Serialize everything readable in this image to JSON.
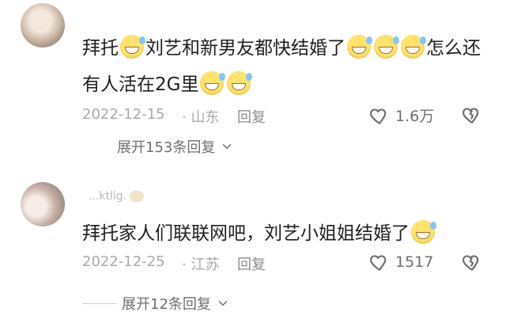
{
  "comments": [
    {
      "username": "",
      "text_parts": [
        {
          "t": "text",
          "v": "拜托"
        },
        {
          "t": "emoji",
          "name": "laugh-sweat-emoji"
        },
        {
          "t": "text",
          "v": "刘艺和新男友都快结婚了"
        },
        {
          "t": "emoji",
          "name": "laugh-sweat-emoji"
        },
        {
          "t": "emoji",
          "name": "laugh-sweat-emoji"
        },
        {
          "t": "emoji",
          "name": "laugh-sweat-emoji"
        },
        {
          "t": "text",
          "v": "怎么还有人活在2G里"
        },
        {
          "t": "emoji",
          "name": "laugh-sweat-emoji"
        },
        {
          "t": "emoji",
          "name": "laugh-sweat-emoji"
        }
      ],
      "date": "2022-12-15",
      "location": "· 山东",
      "reply_label": "回复",
      "likes": "1.6万",
      "expand_label": "展开153条回复"
    },
    {
      "username": "...ktlig.",
      "text_parts": [
        {
          "t": "text",
          "v": "拜托家人们联联网吧，刘艺小姐姐结婚了"
        },
        {
          "t": "emoji",
          "name": "laugh-sweat-emoji"
        }
      ],
      "date": "2022-12-25",
      "location": "· 江苏",
      "reply_label": "回复",
      "likes": "1517",
      "expand_label": "展开12条回复"
    }
  ],
  "colors": {
    "text": "#1f1f1f",
    "meta": "#a9a9a9",
    "action": "#6f6f6f"
  },
  "icons": {
    "like": "heart-outline-icon",
    "dislike": "broken-heart-icon",
    "expand": "chevron-down-icon"
  }
}
